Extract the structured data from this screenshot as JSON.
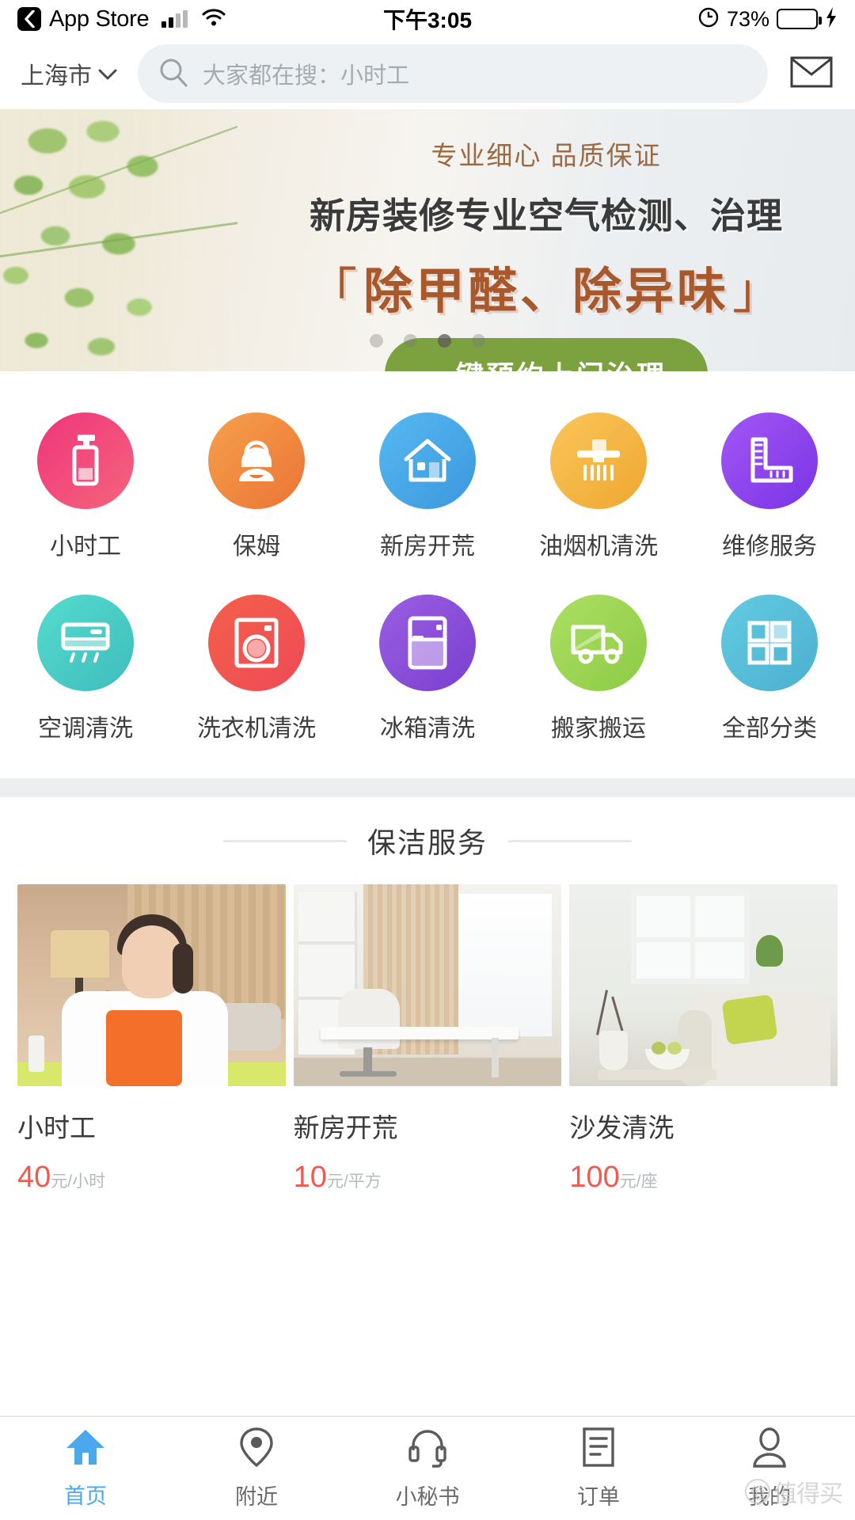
{
  "status_bar": {
    "back_label": "App Store",
    "back_icon": "chevron-left-icon",
    "signal_icon": "cellular-signal-icon",
    "wifi_icon": "wifi-icon",
    "time": "下午3:05",
    "rotation_lock_icon": "rotation-lock-icon",
    "battery_percent": "73%",
    "battery_icon": "battery-icon",
    "charging_icon": "lightning-bolt-icon"
  },
  "header": {
    "city": "上海市",
    "city_chevron_icon": "chevron-down-icon",
    "search_icon": "search-icon",
    "search_placeholder": "大家都在搜：小时工",
    "search_value": "",
    "mail_icon": "envelope-icon"
  },
  "banner": {
    "subtitle": "专业细心 品质保证",
    "title": "新房装修专业空气检测、治理",
    "bracket_open": "「",
    "headline": "除甲醛、除异味",
    "bracket_close": "」",
    "cta_label": "一键预约上门治理",
    "cta_color": "#7ba23f",
    "dots_total": 4,
    "dot_active_index": 2
  },
  "categories": {
    "rows": [
      [
        {
          "label": "小时工",
          "icon": "spray-bottle-icon",
          "color_from": "#f0347d",
          "color_to": "#f4657a"
        },
        {
          "label": "保姆",
          "icon": "nanny-person-icon",
          "color_from": "#f08c3c",
          "color_to": "#ef7b3d"
        },
        {
          "label": "新房开荒",
          "icon": "house-icon",
          "color_from": "#4fb3ef",
          "color_to": "#3f9fe0"
        },
        {
          "label": "油烟机清洗",
          "icon": "range-hood-icon",
          "color_from": "#f7be4c",
          "color_to": "#f0ab36"
        },
        {
          "label": "维修服务",
          "icon": "ruler-square-icon",
          "color_from": "#9a4ff0",
          "color_to": "#7e35e8"
        }
      ],
      [
        {
          "label": "空调清洗",
          "icon": "air-conditioner-icon",
          "color_from": "#4fd2c5",
          "color_to": "#45bfc0"
        },
        {
          "label": "洗衣机清洗",
          "icon": "washing-machine-icon",
          "color_from": "#f0593f",
          "color_to": "#ef4f55"
        },
        {
          "label": "冰箱清洗",
          "icon": "refrigerator-icon",
          "color_from": "#8c4fd8",
          "color_to": "#7a3fce"
        },
        {
          "label": "搬家搬运",
          "icon": "moving-truck-icon",
          "color_from": "#a2d85a",
          "color_to": "#8fcf4a"
        },
        {
          "label": "全部分类",
          "icon": "grid-squares-icon",
          "color_from": "#5bc3dc",
          "color_to": "#4fb6d4"
        }
      ]
    ]
  },
  "section": {
    "title": "保洁服务"
  },
  "services": [
    {
      "title": "小时工",
      "price": "40",
      "unit": "元/小时",
      "image": "cleaner-in-bedroom-photo"
    },
    {
      "title": "新房开荒",
      "price": "10",
      "unit": "元/平方",
      "image": "empty-office-room-photo"
    },
    {
      "title": "沙发清洗",
      "price": "100",
      "unit": "元/座",
      "image": "living-room-sofa-photo"
    }
  ],
  "tabbar": {
    "items": [
      {
        "label": "首页",
        "icon": "home-icon",
        "active": true
      },
      {
        "label": "附近",
        "icon": "location-pin-icon",
        "active": false
      },
      {
        "label": "小秘书",
        "icon": "headset-icon",
        "active": false
      },
      {
        "label": "订单",
        "icon": "order-list-icon",
        "active": false
      },
      {
        "label": "我的",
        "icon": "user-icon",
        "active": false
      }
    ],
    "active_color": "#4aa8ed",
    "inactive_color": "#6a6a6a"
  },
  "watermark": {
    "text": "值得买"
  }
}
